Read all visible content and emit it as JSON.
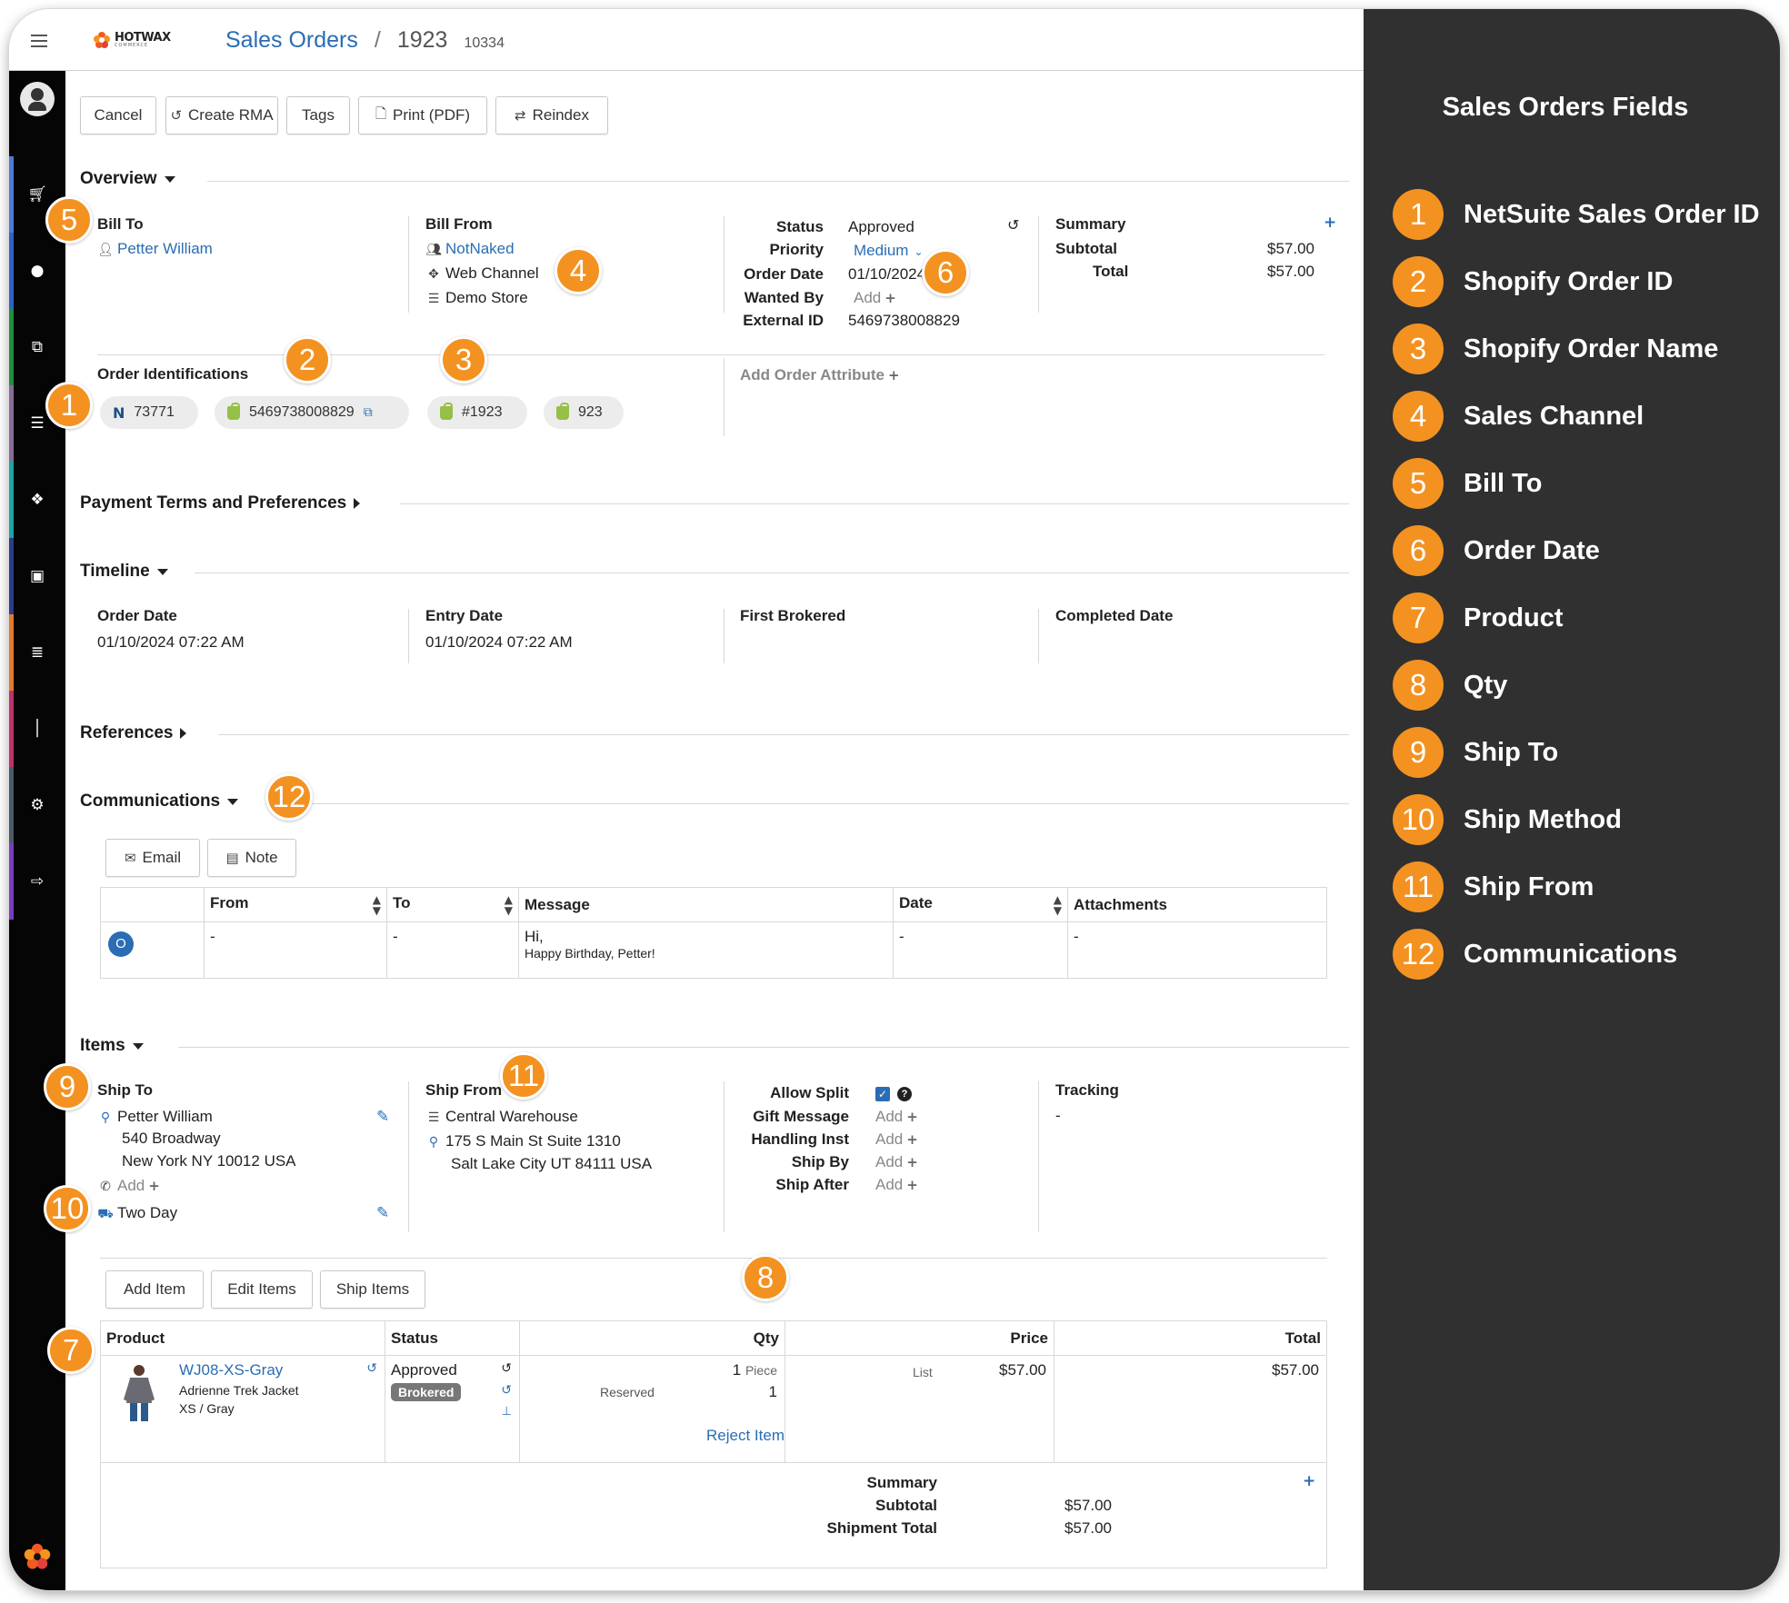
{
  "header": {
    "brand": "HOTWAX",
    "brand_sub": "COMMERCE",
    "breadcrumb_link": "Sales Orders",
    "breadcrumb_sep": "/",
    "order_name": "1923",
    "order_id": "10334"
  },
  "toolbar": {
    "cancel": "Cancel",
    "create_rma": "Create RMA",
    "tags": "Tags",
    "print": "Print (PDF)",
    "reindex": "Reindex"
  },
  "overview": {
    "title": "Overview",
    "bill_to_label": "Bill To",
    "bill_to_name": "Petter William",
    "bill_from_label": "Bill From",
    "bill_from_name": "NotNaked",
    "channel": "Web Channel",
    "store": "Demo Store",
    "status_label": "Status",
    "status_value": "Approved",
    "priority_label": "Priority",
    "priority_value": "Medium",
    "order_date_label": "Order Date",
    "order_date_value": "01/10/2024",
    "wanted_by_label": "Wanted By",
    "wanted_by_value": "Add",
    "external_id_label": "External ID",
    "external_id_value": "5469738008829",
    "summary_label": "Summary",
    "subtotal_label": "Subtotal",
    "subtotal_value": "$57.00",
    "total_label": "Total",
    "total_value": "$57.00",
    "order_ids_label": "Order Identifications",
    "netsuite_id": "73771",
    "shopify_id": "5469738008829",
    "shopify_name": "#1923",
    "other_id": "923",
    "add_attribute": "Add Order Attribute"
  },
  "payment": {
    "title": "Payment Terms and Preferences"
  },
  "timeline": {
    "title": "Timeline",
    "order_date_label": "Order Date",
    "order_date_value": "01/10/2024 07:22 AM",
    "entry_date_label": "Entry Date",
    "entry_date_value": "01/10/2024 07:22 AM",
    "first_brokered_label": "First Brokered",
    "completed_date_label": "Completed Date"
  },
  "references": {
    "title": "References"
  },
  "communications": {
    "title": "Communications",
    "email_button": "Email",
    "note_button": "Note",
    "columns": [
      "From",
      "To",
      "Message",
      "Date",
      "Attachments"
    ],
    "row": {
      "avatar": "O",
      "from": "-",
      "to": "-",
      "message_line1": "Hi,",
      "message_line2": "Happy Birthday, Petter!",
      "date": "-",
      "attachments": "-"
    }
  },
  "items": {
    "title": "Items",
    "ship_to_label": "Ship To",
    "ship_to_name": "Petter William",
    "ship_to_address1": "540 Broadway",
    "ship_to_address2": "New York NY 10012 USA",
    "phone_add": "Add",
    "ship_method": "Two Day",
    "ship_from_label": "Ship From",
    "ship_from_name": "Central Warehouse",
    "ship_from_address1": "175 S Main St Suite 1310",
    "ship_from_address2": "Salt Lake City UT 84111 USA",
    "allow_split_label": "Allow Split",
    "gift_message_label": "Gift Message",
    "handling_inst_label": "Handling Inst",
    "ship_by_label": "Ship By",
    "ship_after_label": "Ship After",
    "add_text": "Add",
    "tracking_label": "Tracking",
    "tracking_value": "-",
    "add_item": "Add Item",
    "edit_items": "Edit Items",
    "ship_items": "Ship Items",
    "columns": [
      "Product",
      "Status",
      "Qty",
      "Price",
      "Total"
    ],
    "line": {
      "sku": "WJ08-XS-Gray",
      "product_name": "Adrienne Trek Jacket",
      "variant": "XS / Gray",
      "status": "Approved",
      "brokered": "Brokered",
      "qty": "1",
      "qty_unit": "Piece",
      "reserved_label": "Reserved",
      "reserved_qty": "1",
      "reject": "Reject Item",
      "price_type": "List",
      "price": "$57.00",
      "total": "$57.00"
    },
    "summary_label": "Summary",
    "subtotal_label": "Subtotal",
    "subtotal_value": "$57.00",
    "shipment_total_label": "Shipment Total",
    "shipment_total_value": "$57.00"
  },
  "legend": {
    "title": "Sales Orders Fields",
    "items": [
      {
        "num": "1",
        "label": "NetSuite Sales Order ID"
      },
      {
        "num": "2",
        "label": "Shopify Order ID"
      },
      {
        "num": "3",
        "label": "Shopify Order Name"
      },
      {
        "num": "4",
        "label": "Sales Channel"
      },
      {
        "num": "5",
        "label": "Bill To"
      },
      {
        "num": "6",
        "label": "Order Date"
      },
      {
        "num": "7",
        "label": "Product"
      },
      {
        "num": "8",
        "label": "Qty"
      },
      {
        "num": "9",
        "label": "Ship To"
      },
      {
        "num": "10",
        "label": "Ship Method"
      },
      {
        "num": "11",
        "label": "Ship From"
      },
      {
        "num": "12",
        "label": "Communications"
      }
    ]
  },
  "markers": [
    "1",
    "2",
    "3",
    "4",
    "5",
    "6",
    "7",
    "8",
    "9",
    "10",
    "11",
    "12"
  ],
  "colors": {
    "accent": "#f39221",
    "link": "#2a6db5",
    "panel": "#303030",
    "sidebar": "#050505"
  }
}
